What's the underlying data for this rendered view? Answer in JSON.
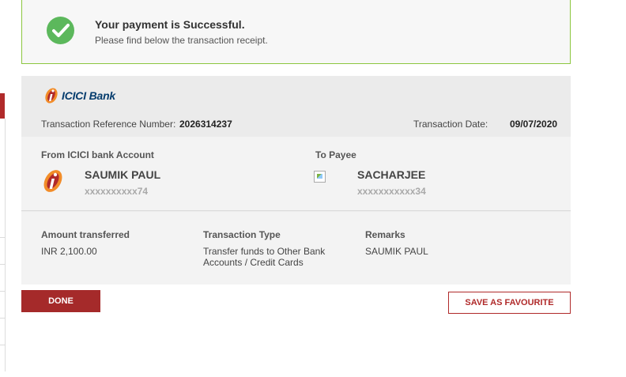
{
  "banner": {
    "title": "Your payment is Successful.",
    "subtitle": "Please find below the transaction receipt.",
    "icon": "check-circle-icon",
    "icon_color": "#5cb85c",
    "border_color": "#8cc63f"
  },
  "receipt": {
    "bank_name": "ICICI Bank",
    "ref_label": "Transaction Reference Number:",
    "ref_value": "2026314237",
    "date_label": "Transaction Date:",
    "date_value": "09/07/2020",
    "from": {
      "label": "From ICICI bank Account",
      "name": "SAUMIK PAUL",
      "account": "xxxxxxxxxx74"
    },
    "to": {
      "label": "To Payee",
      "name": "SACHARJEE",
      "account": "xxxxxxxxxxx34"
    },
    "amount": {
      "label": "Amount transferred",
      "value": "INR 2,100.00"
    },
    "type": {
      "label": "Transaction Type",
      "value_line1": "Transfer funds to Other Bank",
      "value_line2": "Accounts / Credit Cards"
    },
    "remarks": {
      "label": "Remarks",
      "value": "SAUMIK PAUL"
    }
  },
  "actions": {
    "done_label": "DONE",
    "favourite_label": "SAVE AS FAVOURITE",
    "brand_color": "#a52a2a"
  }
}
